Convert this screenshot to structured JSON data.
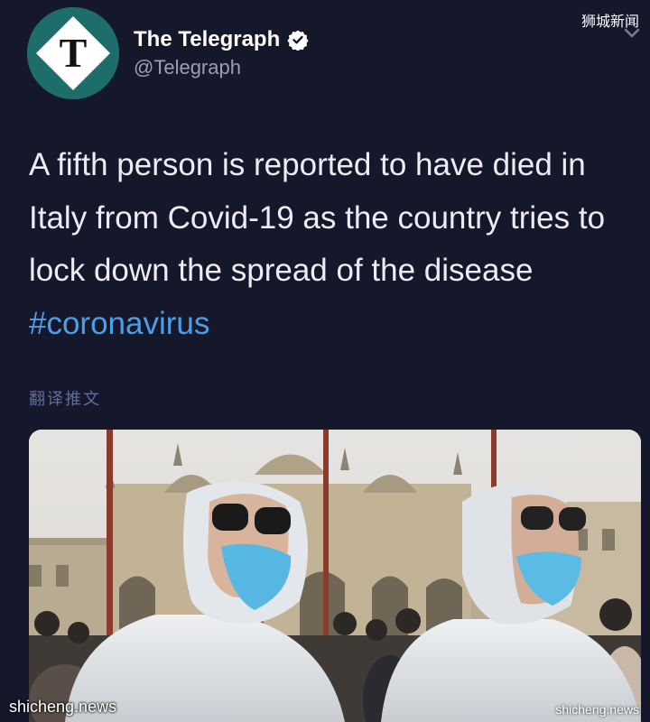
{
  "watermark": {
    "top_right": "狮城新闻",
    "bottom_left": "shicheng.news",
    "bottom_right": "shicheng.news"
  },
  "account": {
    "display_name": "The Telegraph",
    "handle": "@Telegraph",
    "avatar_letter": "T",
    "verified": true,
    "avatar_color": "#1d6d6b"
  },
  "tweet": {
    "text": "A fifth person is reported to have died in Italy from Covid-19 as the country tries to lock down the spread of the disease",
    "hashtag": "#coronavirus",
    "hashtag_color": "#4a9fe8",
    "translate_label": "翻译推文"
  },
  "icons": {
    "menu": "chevron-down-icon",
    "verified": "verified-badge-icon"
  }
}
